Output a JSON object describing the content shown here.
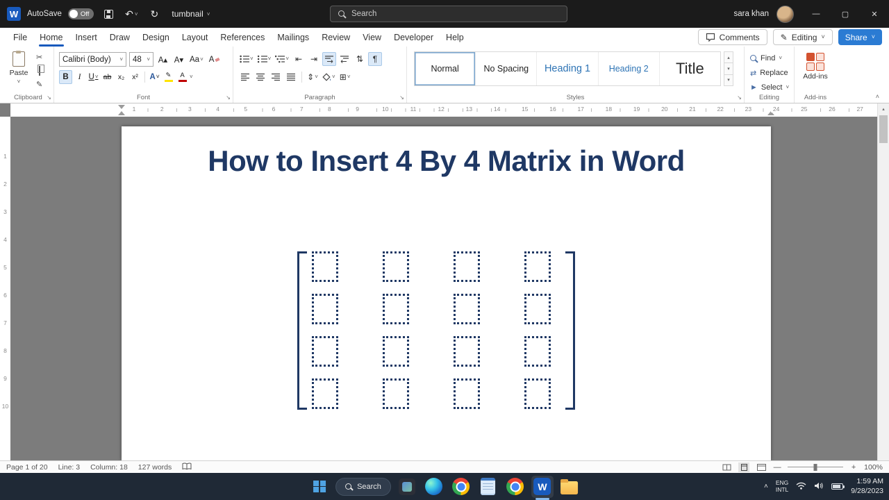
{
  "colors": {
    "accent_blue": "#185abd",
    "doc_text_navy": "#1f3864",
    "heading_blue": "#2e74b5",
    "share_blue": "#2b7bd3",
    "highlight_yellow": "#ffe400",
    "font_color_red": "#c00000"
  },
  "titlebar": {
    "autosave_label": "AutoSave",
    "autosave_state": "Off",
    "doc_name": "tumbnail",
    "search_placeholder": "Search",
    "user_name": "sara khan"
  },
  "menu": {
    "tabs": [
      "File",
      "Home",
      "Insert",
      "Draw",
      "Design",
      "Layout",
      "References",
      "Mailings",
      "Review",
      "View",
      "Developer",
      "Help"
    ],
    "active_tab": "Home",
    "comments_label": "Comments",
    "editing_label": "Editing",
    "share_label": "Share"
  },
  "ribbon": {
    "paste_label": "Paste",
    "clipboard_group": "Clipboard",
    "font_name": "Calibri (Body)",
    "font_size": "48",
    "font_group": "Font",
    "paragraph_group": "Paragraph",
    "styles": [
      "Normal",
      "No Spacing",
      "Heading 1",
      "Heading 2",
      "Title"
    ],
    "styles_selected": "Normal",
    "styles_group": "Styles",
    "find_label": "Find",
    "replace_label": "Replace",
    "select_label": "Select",
    "editing_group": "Editing",
    "addins_label": "Add-ins",
    "addins_group": "Add-ins"
  },
  "ruler": {
    "h_numbers": [
      "1",
      "2",
      "3",
      "4",
      "5",
      "6",
      "7",
      "8",
      "9",
      "10",
      "11",
      "12",
      "13",
      "14",
      "15",
      "16",
      "17",
      "18",
      "19",
      "20",
      "21",
      "22",
      "23",
      "24",
      "25",
      "26",
      "27"
    ],
    "v_numbers": [
      "1",
      "2",
      "3",
      "4",
      "5",
      "6",
      "7",
      "8",
      "9",
      "10"
    ]
  },
  "document": {
    "title": "How to Insert 4 By 4 Matrix in Word",
    "matrix_rows": 4,
    "matrix_cols": 4
  },
  "statusbar": {
    "page": "Page 1 of 20",
    "line": "Line: 3",
    "column": "Column: 18",
    "words": "127 words",
    "zoom": "100%"
  },
  "taskbar": {
    "search_label": "Search",
    "lang_top": "ENG",
    "lang_bottom": "INTL",
    "time": "1:59 AM",
    "date": "9/28/2023"
  },
  "icons": {
    "word_logo": "W",
    "undo": "↶",
    "redo": "↻",
    "scissors": "✂",
    "format_painter": "✎",
    "pilcrow": "¶",
    "sort": "⇅",
    "outdent": "⇤",
    "indent": "⇥",
    "borders": "⊞",
    "replace": "⇄",
    "select": "►",
    "bold": "B",
    "italic": "I",
    "underline": "U",
    "strikethrough": "ab",
    "subscript": "x₂",
    "superscript": "x²",
    "text_effects": "A",
    "highlight_pen": "✎",
    "font_color": "A",
    "grow_font": "A▴",
    "shrink_font": "A▾",
    "change_case": "Aa",
    "clear_formatting": "A",
    "chevron_down": "˅",
    "chevron_up": "˄",
    "dialog_launcher": "↘",
    "scroll_up": "▴",
    "scroll_down": "▾",
    "more": "▾",
    "minimize": "—",
    "maximize": "▢",
    "close": "✕",
    "line_spacing": "⇕",
    "zoom_out": "—",
    "zoom_in": "+"
  }
}
